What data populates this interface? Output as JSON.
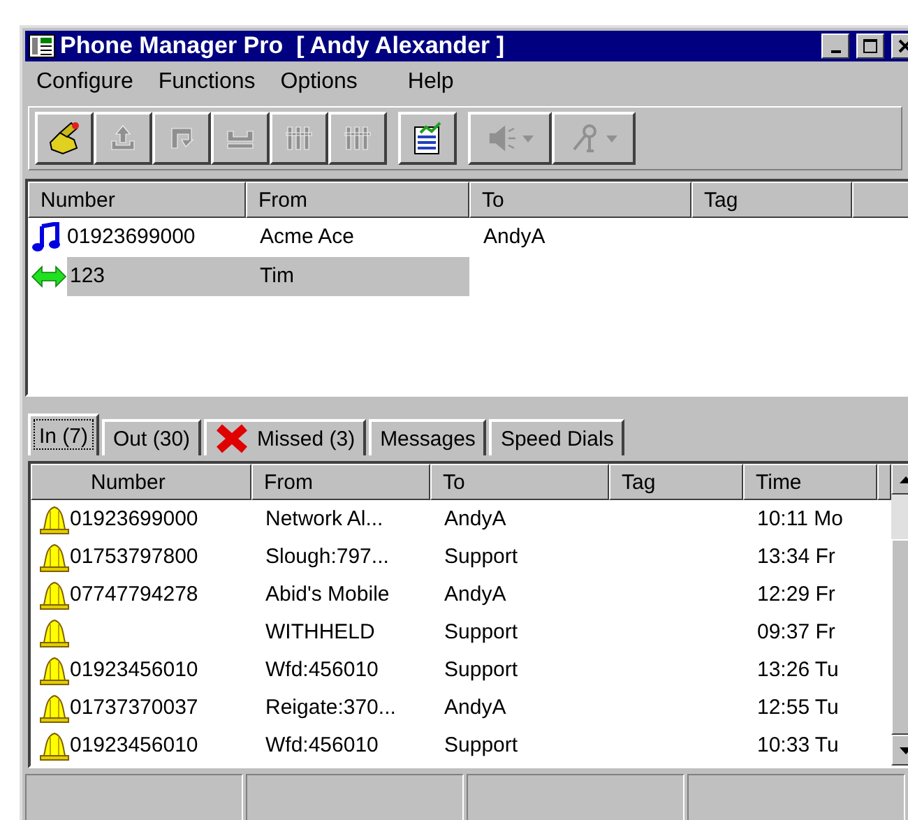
{
  "window": {
    "title": "Phone Manager Pro  [ Andy Alexander ]"
  },
  "menu": [
    "Configure",
    "Functions",
    "Options",
    "Help"
  ],
  "toolbar": [
    {
      "kind": "phone",
      "disabled": false
    },
    {
      "kind": "upload",
      "disabled": true
    },
    {
      "kind": "swap",
      "disabled": true
    },
    {
      "kind": "hold",
      "disabled": true
    },
    {
      "kind": "bars",
      "disabled": true
    },
    {
      "kind": "bars",
      "disabled": true
    },
    {
      "kind": "separator"
    },
    {
      "kind": "notepad",
      "disabled": false
    },
    {
      "kind": "separator"
    },
    {
      "kind": "speaker",
      "disabled": true,
      "dropdown": true
    },
    {
      "kind": "microphone",
      "disabled": true,
      "dropdown": true
    }
  ],
  "active_calls": {
    "columns": [
      "Number",
      "From",
      "To",
      "Tag"
    ],
    "rows": [
      {
        "kind": "ringing",
        "selected": false,
        "cells": [
          "01923699000",
          "Acme Ace",
          "AndyA",
          ""
        ]
      },
      {
        "kind": "connected",
        "selected": true,
        "cells": [
          "123",
          "Tim",
          "",
          ""
        ]
      }
    ]
  },
  "tabs": [
    {
      "label": "In (7)",
      "selected": true
    },
    {
      "label": "Out (30)",
      "selected": false
    },
    {
      "label": "Missed (3)",
      "selected": false,
      "kind": "missed"
    },
    {
      "label": "Messages",
      "selected": false
    },
    {
      "label": "Speed Dials",
      "selected": false
    }
  ],
  "calls": {
    "columns": [
      "Number",
      "From",
      "To",
      "Tag",
      "Time"
    ],
    "rows": [
      {
        "cells": [
          "01923699000",
          "Network Al...",
          "AndyA",
          "",
          "10:11 Mo"
        ]
      },
      {
        "cells": [
          "01753797800",
          "Slough:797...",
          "Support",
          "",
          "13:34 Fr"
        ]
      },
      {
        "cells": [
          "07747794278",
          "Abid's Mobile",
          "AndyA",
          "",
          "12:29 Fr"
        ]
      },
      {
        "cells": [
          "",
          "WITHHELD",
          "Support",
          "",
          "09:37 Fr"
        ]
      },
      {
        "cells": [
          "01923456010",
          "Wfd:456010",
          "Support",
          "",
          "13:26 Tu"
        ]
      },
      {
        "cells": [
          "01737370037",
          "Reigate:370...",
          "AndyA",
          "",
          "12:55 Tu"
        ]
      },
      {
        "cells": [
          "01923456010",
          "Wfd:456010",
          "Support",
          "",
          "10:33 Tu"
        ]
      }
    ]
  }
}
